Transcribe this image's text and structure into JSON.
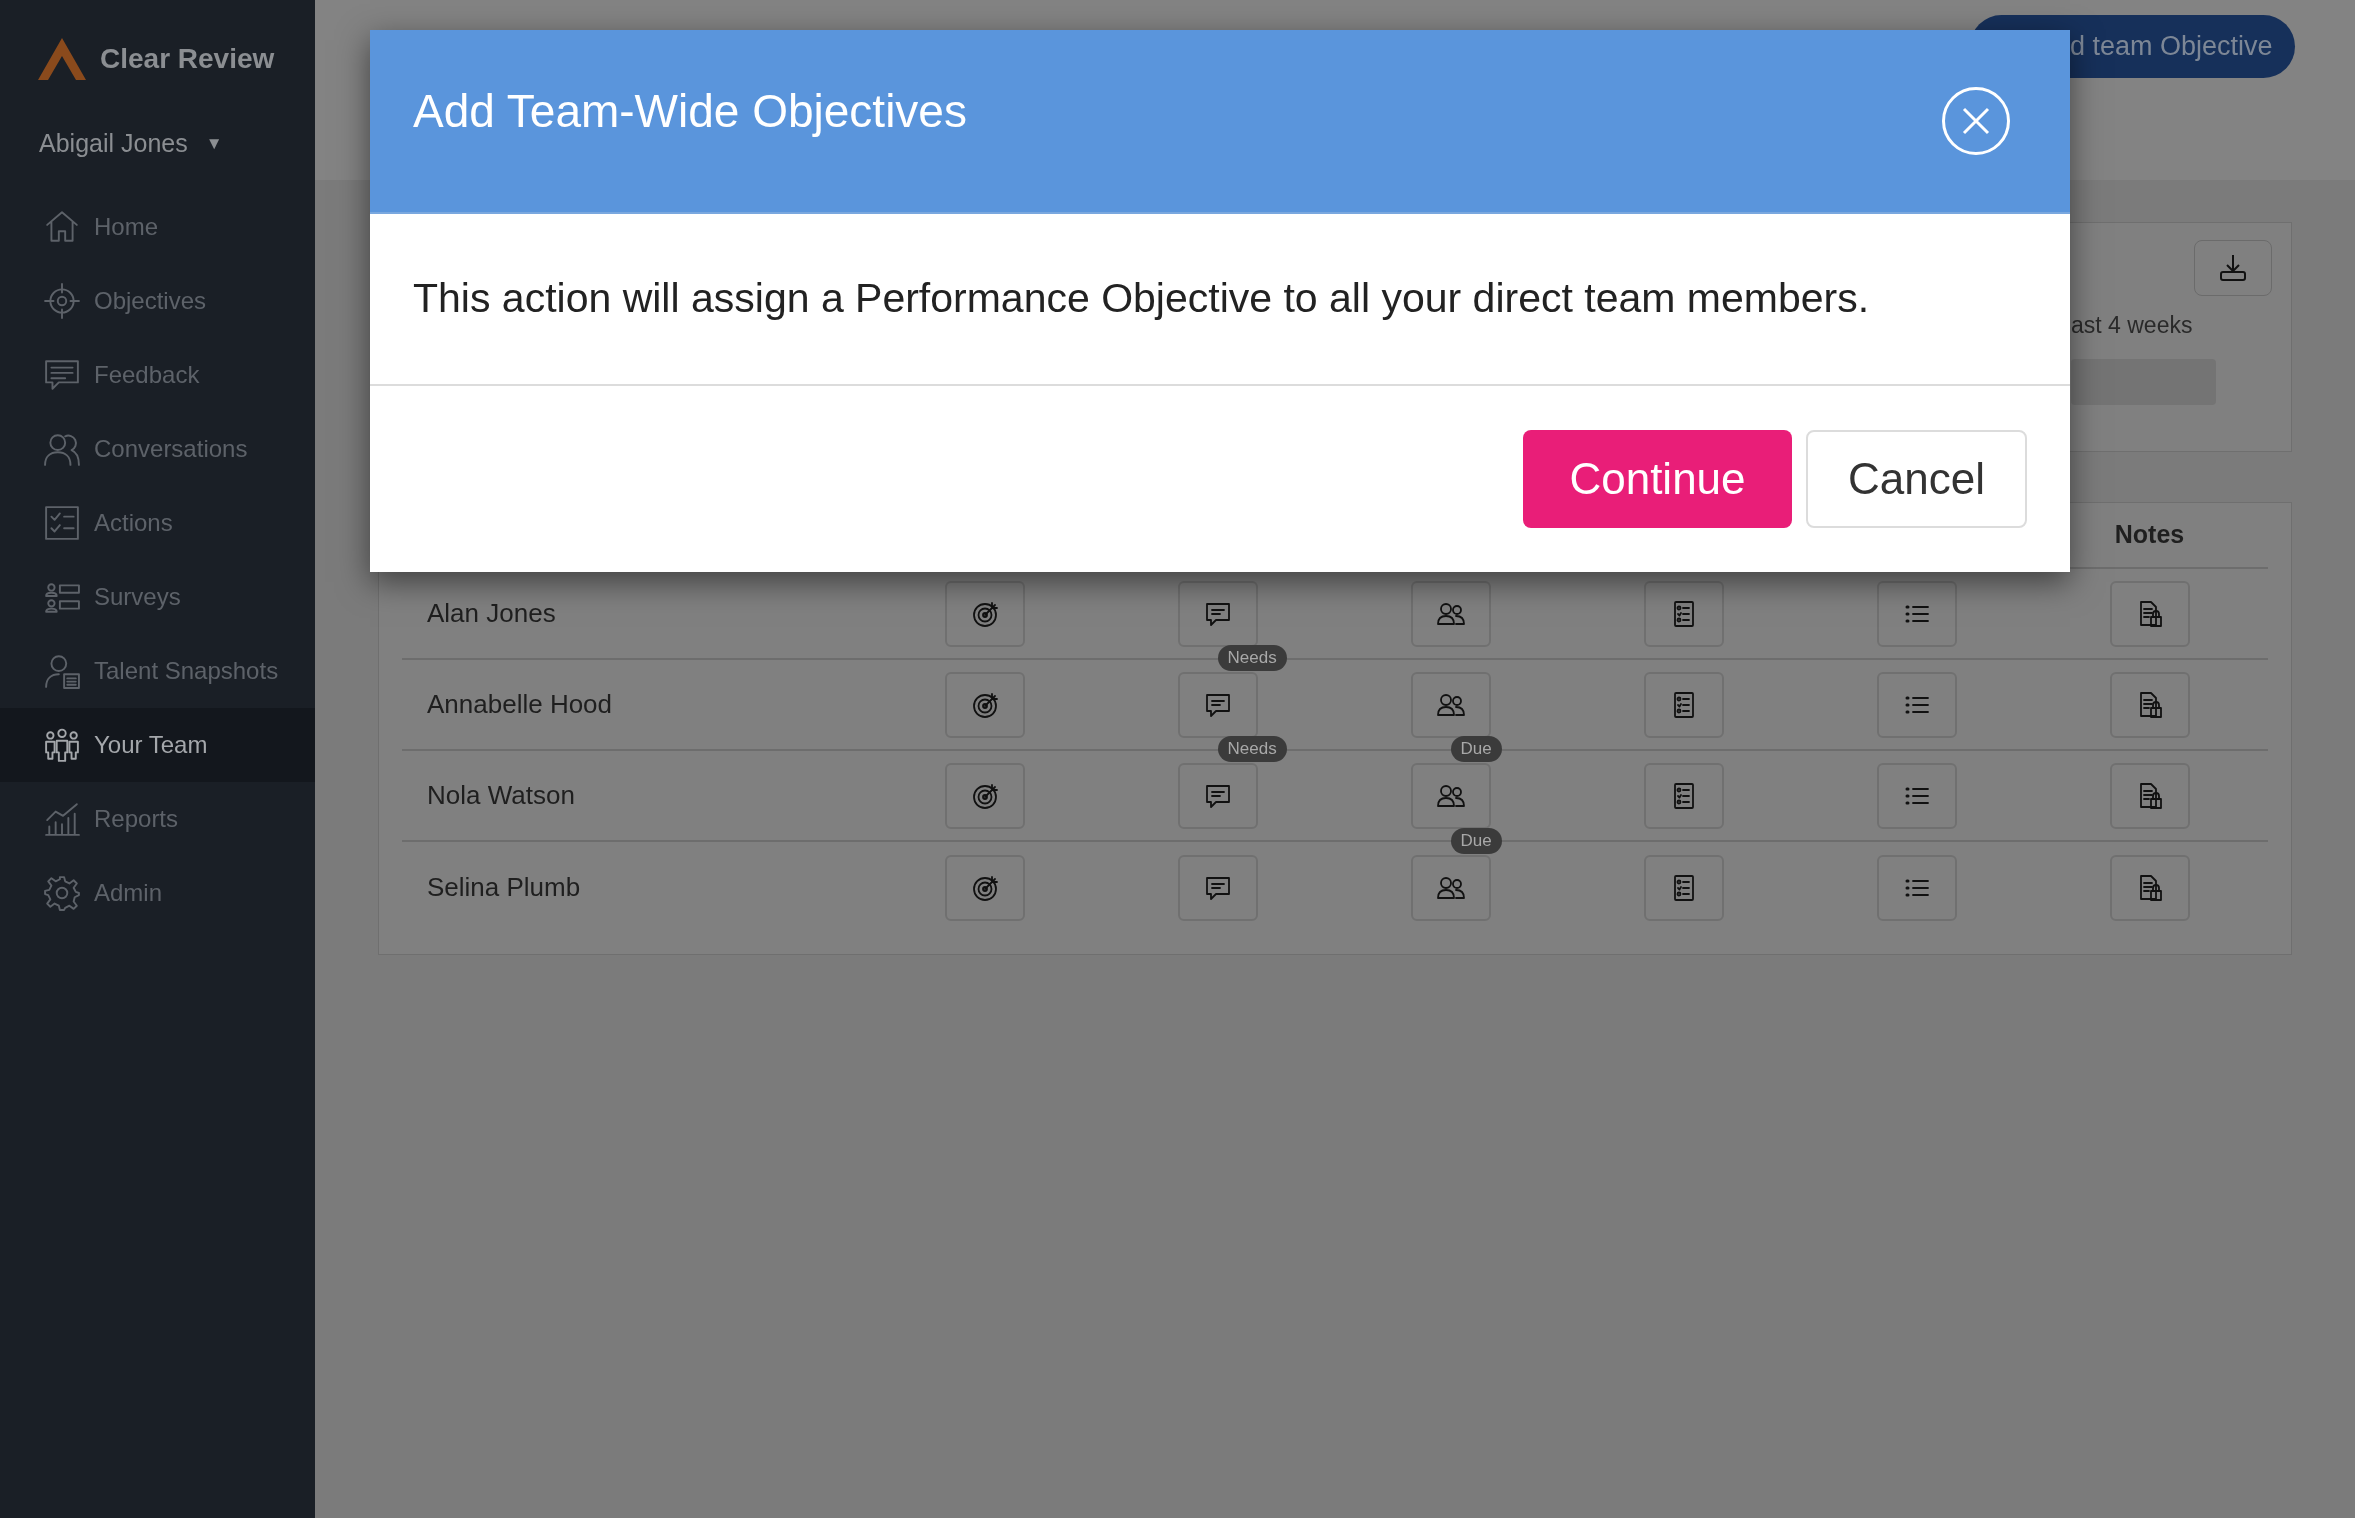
{
  "sidebar": {
    "brand": "Clear Review",
    "user": "Abigail Jones",
    "user_caret": "▼",
    "items": [
      {
        "kind": "home",
        "label": "Home",
        "selected": false
      },
      {
        "kind": "objectives",
        "label": "Objectives",
        "selected": false
      },
      {
        "kind": "feedback",
        "label": "Feedback",
        "selected": false
      },
      {
        "kind": "conversations",
        "label": "Conversations",
        "selected": false
      },
      {
        "kind": "actions",
        "label": "Actions",
        "selected": false
      },
      {
        "kind": "surveys",
        "label": "Surveys",
        "selected": false
      },
      {
        "kind": "talent",
        "label": "Talent Snapshots",
        "selected": false
      },
      {
        "kind": "team",
        "label": "Your Team",
        "selected": true
      },
      {
        "kind": "reports",
        "label": "Reports",
        "selected": false
      },
      {
        "kind": "admin",
        "label": "Admin",
        "selected": false
      }
    ]
  },
  "top_button": "d team Objective",
  "summary_card": {
    "caption": "ast 4 weeks"
  },
  "table": {
    "notes_header": "Notes",
    "rows": [
      {
        "name": "Alan Jones"
      },
      {
        "name": "Annabelle Hood",
        "feedback_badge": "Needs"
      },
      {
        "name": "Nola Watson",
        "feedback_badge": "Needs",
        "conversation_badge": "Due"
      },
      {
        "name": "Selina Plumb",
        "conversation_badge": "Due"
      }
    ]
  },
  "modal": {
    "title": "Add Team-Wide Objectives",
    "message": "This action will assign a Performance Objective to all your direct team members.",
    "continue_button": "Continue",
    "cancel_button": "Cancel"
  }
}
